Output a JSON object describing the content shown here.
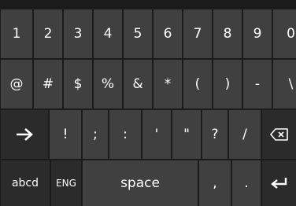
{
  "keyboard": {
    "row1": [
      "1",
      "2",
      "3",
      "4",
      "5",
      "6",
      "7",
      "8",
      "9",
      "0"
    ],
    "row2": [
      "@",
      "#",
      "$",
      "%",
      "&",
      "*",
      "(",
      ")",
      "-",
      "\\"
    ],
    "row3": [
      "!",
      ";",
      ":",
      "'",
      "\"",
      "?",
      "/"
    ],
    "row4": {
      "abcd": "abcd",
      "lang": "ENG",
      "space": "space",
      "comma": ",",
      "period": "."
    },
    "icons": {
      "tab": "arrow-right-icon",
      "backspace": "backspace-icon",
      "enter": "enter-icon"
    }
  }
}
